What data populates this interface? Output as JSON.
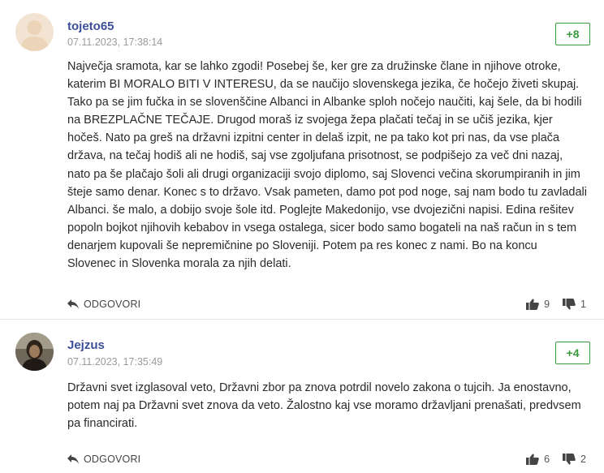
{
  "comments": [
    {
      "author": "tojeto65",
      "date": "07.11.2023, 17:38:14",
      "score": "+8",
      "text": "Največja sramota, kar se lahko zgodi! Posebej še, ker gre za družinske člane in njihove otroke, katerim BI MORALO BITI V INTERESU, da se naučijo slovenskega jezika, če hočejo živeti skupaj. Tako pa se jim fučka in se slovenščine Albanci in Albanke sploh nočejo naučiti, kaj šele, da bi hodili na BREZPLAČNE TEČAJE. Drugod moraš iz svojega žepa plačati tečaj in se učiš jezika, kjer hočeš. Nato pa greš na državni izpitni center in delaš izpit, ne pa tako kot pri nas, da vse plača država, na tečaj hodiš ali ne hodiš, saj vse zgoljufana prisotnost, se podpišejo za več dni nazaj, nato pa še plačajo šoli ali drugi organizaciji svojo diplomo, saj Slovenci večina skorumpiranih in jim šteje samo denar. Konec s to državo. Vsak pameten, damo pot pod noge, saj nam bodo tu zavladali Albanci. še malo, a dobijo svoje šole itd. Poglejte Makedonijo, vse dvojezični napisi. Edina rešitev popoln bojkot njihovih kebabov in vsega ostalega, sicer bodo samo bogateli na naš račun in s tem denarjem kupovali še nepremičnine po Sloveniji. Potem pa res konec z nami. Bo na koncu Slovenec in Slovenka morala za njih delati.",
      "reply_label": "ODGOVORI",
      "likes": "9",
      "dislikes": "1"
    },
    {
      "author": "Jejzus",
      "date": "07.11.2023, 17:35:49",
      "score": "+4",
      "text": "Državni svet izglasoval veto, Državni zbor pa znova potrdil novelo zakona o tujcih. Ja enostavno, potem naj pa Državni svet znova da veto. Žalostno kaj vse moramo državljani prenašati, predvsem pa financirati.",
      "reply_label": "ODGOVORI",
      "likes": "6",
      "dislikes": "2"
    }
  ],
  "colors": {
    "author": "#3d4f9a",
    "score": "#3a9a3e",
    "date": "#9a9a9a"
  },
  "icons": {
    "reply": "reply-icon",
    "like": "thumbs-up-icon",
    "dislike": "thumbs-down-icon",
    "avatar_default": "user-avatar-icon"
  }
}
